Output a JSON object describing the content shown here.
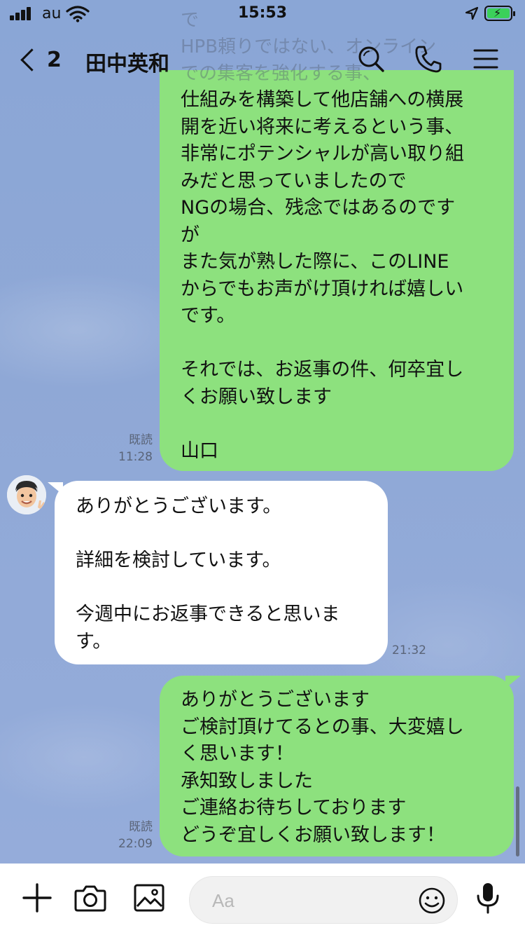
{
  "status_bar": {
    "carrier": "au",
    "time": "15:53"
  },
  "header": {
    "back_count": "2",
    "title": "田中英和",
    "overlay_text": "で\nHPB頼りではない、オンライン\nでの集客を強化する事、"
  },
  "messages": [
    {
      "direction": "out",
      "text": "仕組みを構築して他店舗への横展\n開を近い将来に考えるという事、\n非常にポテンシャルが高い取り組\nみだと思っていましたので\nNGの場合、残念ではあるのです\nが\nまた気が熟した際に、このLINE\nからでもお声がけ頂ければ嬉しい\nです。\n\nそれでは、お返事の件、何卒宜し\nくお願い致します\n\n山口",
      "read": "既読",
      "time": "11:28"
    },
    {
      "direction": "in",
      "text": "ありがとうございます。\n\n詳細を検討しています。\n\n今週中にお返事できると思いま\nす。",
      "time": "21:32"
    },
    {
      "direction": "out",
      "text": "ありがとうございます\nご検討頂けてるとの事、大変嬉し\nく思います！\n承知致しました\nご連絡お待ちしております\nどうぞ宜しくお願い致します！",
      "read": "既読",
      "time": "22:09"
    }
  ],
  "composer": {
    "placeholder": "Aa"
  },
  "colors": {
    "outgoing_bubble": "#8de17e",
    "incoming_bubble": "#ffffff",
    "background": "#8ea8d4"
  },
  "icons": [
    "signal-icon",
    "wifi-icon",
    "location-icon",
    "battery-icon",
    "back-chevron-icon",
    "search-icon",
    "phone-icon",
    "menu-icon",
    "plus-icon",
    "camera-icon",
    "image-icon",
    "emoji-icon",
    "microphone-icon"
  ]
}
